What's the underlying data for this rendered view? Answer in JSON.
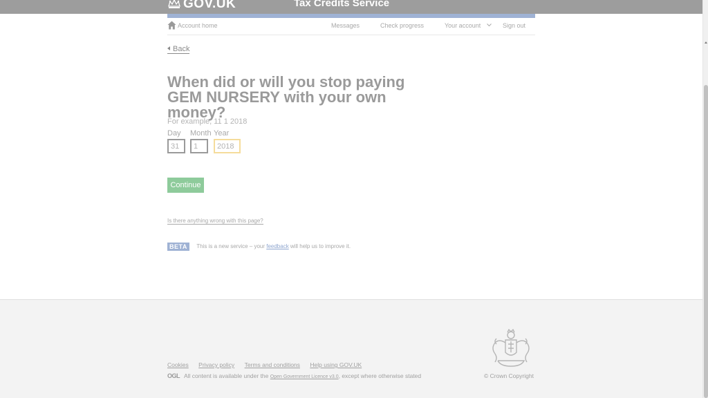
{
  "header": {
    "logo_text": "GOV.UK",
    "service_name": "Tax Credits Service",
    "colors": {
      "header_bg": "#9d9d9d",
      "service_bar": "#9fb2d4"
    }
  },
  "account_nav": {
    "home_label": "Account home",
    "items": [
      {
        "label": "Messages"
      },
      {
        "label": "Check progress"
      },
      {
        "label": "Your account"
      },
      {
        "label": "Sign out"
      }
    ]
  },
  "back_label": "Back",
  "question": {
    "title": "When did or will you stop paying GEM NURSERY with your own money?",
    "hint": "For example, 11 1 2018"
  },
  "date_fields": {
    "day": {
      "label": "Day",
      "value": "31"
    },
    "month": {
      "label": "Month",
      "value": "1"
    },
    "year": {
      "label": "Year",
      "value": "2018"
    }
  },
  "continue_label": "Continue",
  "report_link": "Is there anything wrong with this page?",
  "beta": {
    "tag": "BETA",
    "text_before": "This is a new service – your ",
    "link": "feedback",
    "text_after": " will help us to improve it."
  },
  "footer": {
    "links": [
      "Cookies",
      "Privacy policy",
      "Terms and conditions",
      "Help using GOV.UK"
    ],
    "ogl_logo": "OGL",
    "licence_before": "All content is available under the ",
    "licence_link": "Open Government Licence v3.0",
    "licence_after": ", except where otherwise stated",
    "copyright": "© Crown Copyright",
    "crest_icon": "royal-coat-of-arms-icon"
  }
}
